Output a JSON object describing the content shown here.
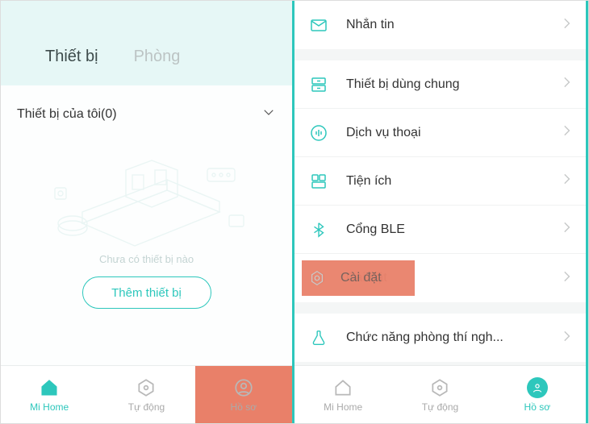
{
  "left": {
    "tabs": {
      "device": "Thiết bị",
      "room": "Phòng"
    },
    "my_devices_label": "Thiết bị của tôi(0)",
    "empty_text": "Chưa có thiết bị nào",
    "add_button": "Thêm thiết bị"
  },
  "right": {
    "items": {
      "message": "Nhắn tin",
      "shared_devices": "Thiết bị dùng chung",
      "voice_service": "Dịch vụ thoại",
      "widgets": "Tiện ích",
      "ble_gateway": "Cổng BLE",
      "settings": "Cài đặt",
      "lab": "Chức năng phòng thí ngh..."
    }
  },
  "nav": {
    "home": "Mi Home",
    "auto": "Tự động",
    "profile": "Hồ sơ"
  }
}
